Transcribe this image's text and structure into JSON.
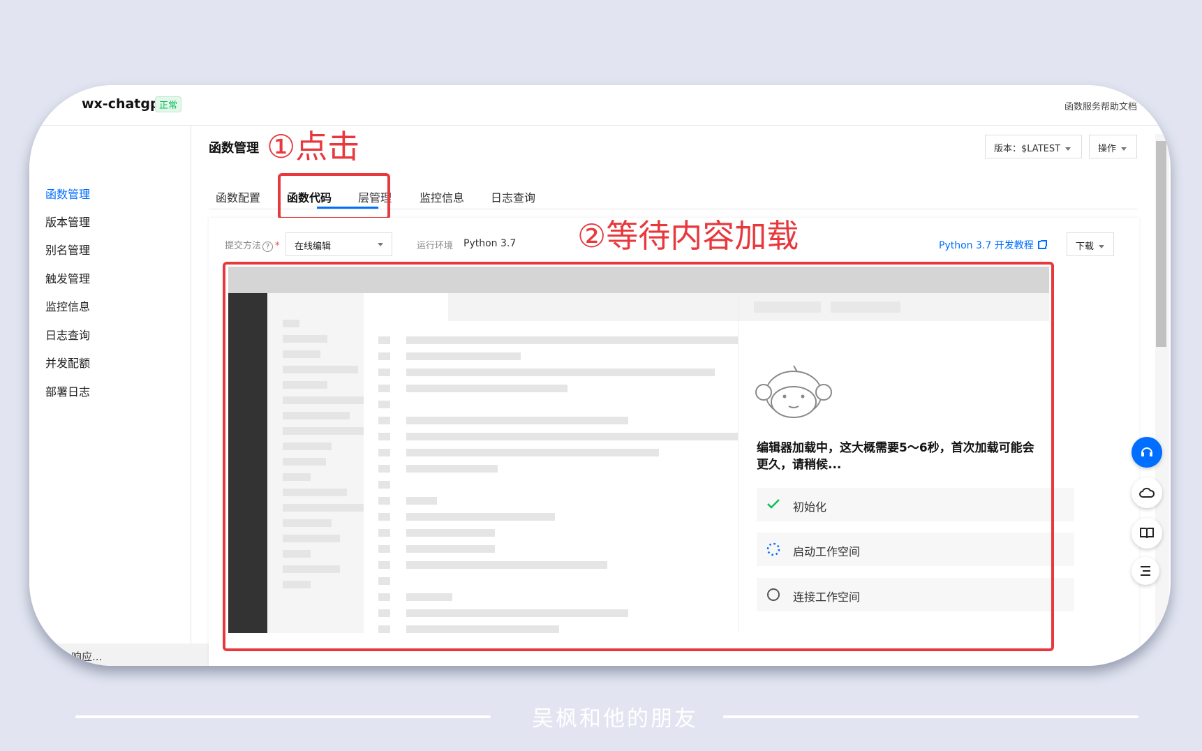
{
  "app": {
    "name": "wx-chatgpt",
    "status": "正常",
    "help_link": "函数服务帮助文档"
  },
  "sidebar": {
    "items": [
      {
        "label": "函数管理",
        "active": true
      },
      {
        "label": "版本管理"
      },
      {
        "label": "别名管理"
      },
      {
        "label": "触发管理"
      },
      {
        "label": "监控信息"
      },
      {
        "label": "日志查询"
      },
      {
        "label": "并发配额"
      },
      {
        "label": "部署日志"
      }
    ],
    "bottom_text": "响应..."
  },
  "header": {
    "title": "函数管理",
    "version_label": "版本：$LATEST",
    "operation_label": "操作"
  },
  "tabs": [
    {
      "label": "函数配置"
    },
    {
      "label": "函数代码",
      "active": true
    },
    {
      "label": "层管理"
    },
    {
      "label": "监控信息"
    },
    {
      "label": "日志查询"
    }
  ],
  "form": {
    "submit_method_label": "提交方法",
    "submit_method_value": "在线编辑",
    "runtime_label": "运行环境",
    "runtime_value": "Python 3.7",
    "tutorial_link": "Python 3.7 开发教程",
    "download_label": "下载"
  },
  "loader": {
    "title": "编辑器加载中，这大概需要5～6秒，首次加载可能会更久，请稍候...",
    "steps": [
      {
        "label": "初始化",
        "state": "done"
      },
      {
        "label": "启动工作空间",
        "state": "loading"
      },
      {
        "label": "连接工作空间",
        "state": "pending"
      }
    ]
  },
  "annotations": {
    "step1": "①点击",
    "step2": "②等待内容加载"
  },
  "footer": {
    "text": "吴枫和他的朋友"
  },
  "colors": {
    "accent": "#006eff",
    "annotation": "#e8383d",
    "success": "#0abf5b",
    "background": "#e2e5f1"
  }
}
